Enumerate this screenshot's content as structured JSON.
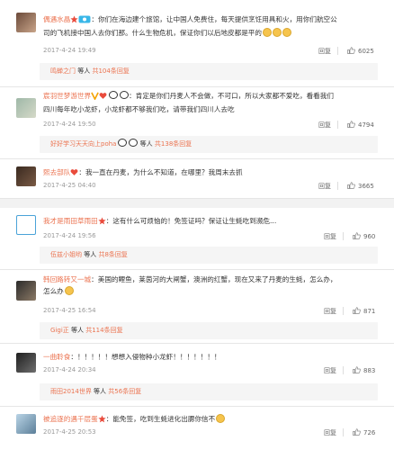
{
  "colors": {
    "accent": "#eb7350",
    "muted": "#999999",
    "subbg": "#f5f5f5",
    "gap": "#f2f2f2"
  },
  "comments": [
    {
      "user": "偶遇水晶",
      "text_lines": [
        "：你们在海边建个旅馆，让中国人免费住，每天提供烹饪用具和火，用你们航空公",
        "司的飞机接中国人去你们那。什么生物危机，保证你们以后地皮都是平的"
      ],
      "time": "2017-4-24 19:49",
      "reply": "回复",
      "likes": "6025",
      "sub": {
        "user": "鸣蝉之门",
        "mid": " 等人 ",
        "count": "共104条回复"
      }
    },
    {
      "user": "宸羽世梦游世界",
      "text_lines": [
        "：肯定是你们丹麦人不会做，不可口，所以大家都不爱吃，看看我们",
        "四川每年吃小龙虾，小龙虾都不够我们吃，请带我们四川人去吃"
      ],
      "time": "2017-4-24 19:50",
      "reply": "回复",
      "likes": "4794",
      "sub": {
        "user": "好好学习天天向上poha",
        "mid": " 等人 ",
        "count": "共138条回复"
      }
    },
    {
      "user": "熙去部队",
      "text_lines": [
        "：我一直在丹麦，为什么不知道，在哪里？我周末去抓"
      ],
      "time": "2017-4-25 04:40",
      "reply": "回复",
      "likes": "3665"
    },
    {
      "user": "我才是雨田草雨田",
      "text_lines": [
        "：这有什么可烦恼的！免签证吗？保证让生蚝吃到濒危..."
      ],
      "time": "2017-4-24 19:56",
      "reply": "回复",
      "likes": "960",
      "sub": {
        "user": "伍兹小姐哟",
        "mid": " 等人 ",
        "count": "共8条回复"
      }
    },
    {
      "user": "韩回路转又一城",
      "text_lines": [
        "：美国的鲤鱼，莱茵河的大闸蟹，澳洲的红蟹，现在又来了丹麦的生蚝，怎么办，",
        "怎么办"
      ],
      "time": "2017-4-25 16:54",
      "reply": "回复",
      "likes": "871",
      "sub": {
        "user": "Gigi正",
        "mid": " 等人 ",
        "count": "共114条回复"
      }
    },
    {
      "user": "一曲聆食",
      "text_lines": [
        "：！！！！！想想入侵物种小龙虾！！！！！！！"
      ],
      "time": "2017-4-24 20:34",
      "reply": "回复",
      "likes": "883",
      "sub": {
        "user": "雨田2014世界",
        "mid": " 等人 ",
        "count": "共56条回复"
      }
    },
    {
      "user": "被追逐的遇千层蛋",
      "text_lines": [
        "：能免签，吃到生蚝进化出腮你信不"
      ],
      "time": "2017-4-25 20:53",
      "reply": "回复",
      "likes": "726"
    }
  ]
}
